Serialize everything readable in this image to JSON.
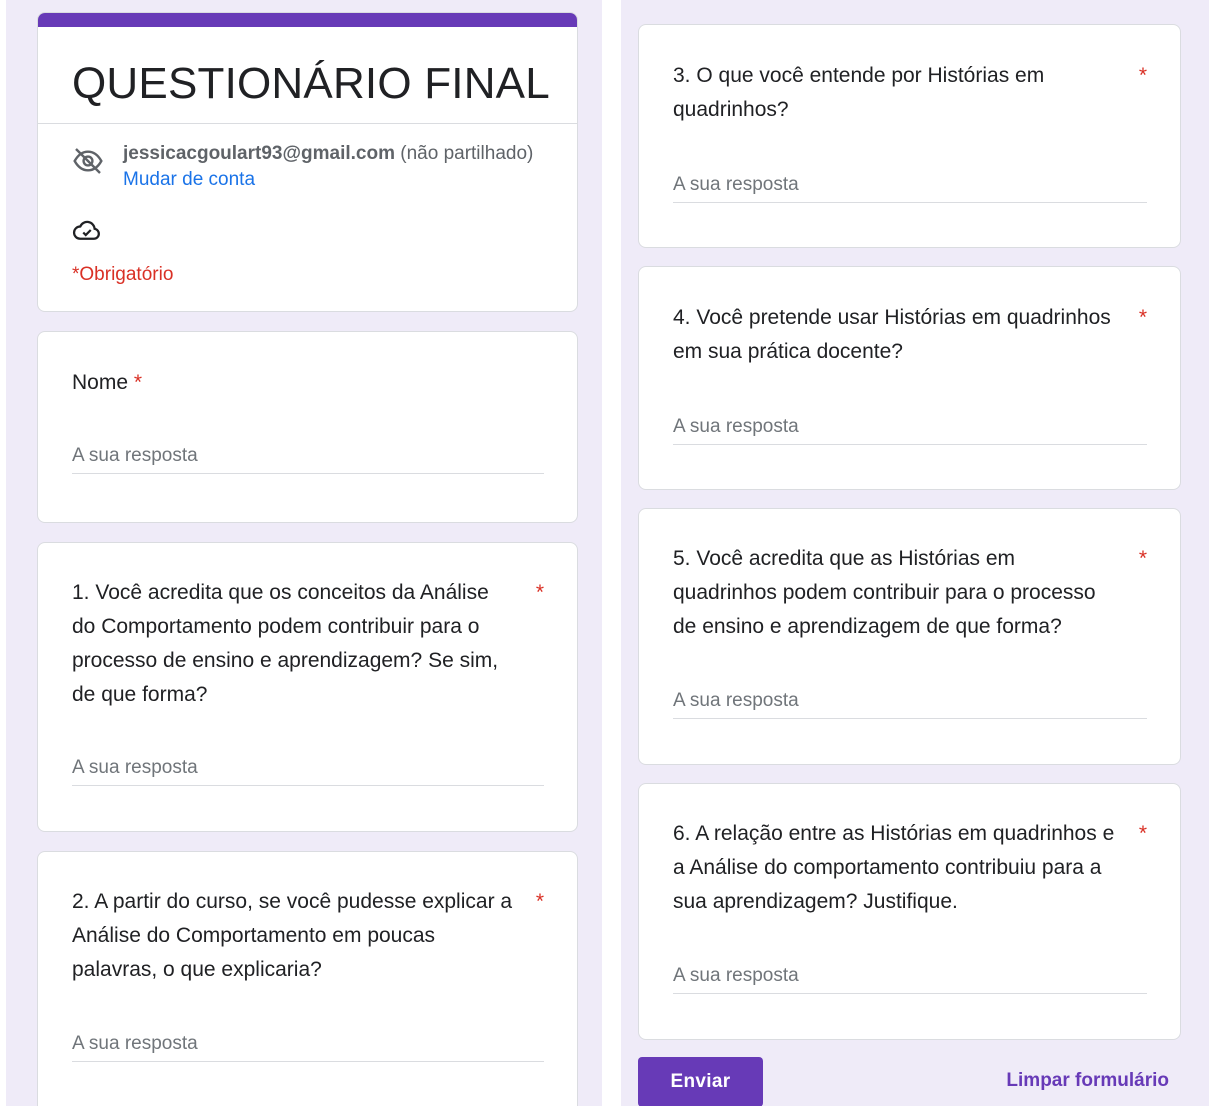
{
  "header": {
    "title": "QUESTIONÁRIO FINAL",
    "email": "jessicacgoulart93@gmail.com",
    "not_shared": "(não partilhado)",
    "switch_account": "Mudar de conta",
    "required_note": "*Obrigatório"
  },
  "colors": {
    "accent": "#673ab7",
    "link": "#1a73e8",
    "required": "#d93025",
    "background": "#efebf8"
  },
  "icons": {
    "account": "eye-off-icon",
    "save_status": "cloud-check-icon"
  },
  "answer_placeholder": "A sua resposta",
  "questions": [
    {
      "text": "Nome",
      "required_mark": "*"
    },
    {
      "text": "1. Você acredita que os conceitos da Análise do Comportamento podem contribuir para o processo de ensino e aprendizagem? Se sim, de que forma?",
      "required_mark": "*"
    },
    {
      "text": "2. A partir do curso, se você pudesse explicar a Análise do Comportamento em poucas palavras, o que explicaria?",
      "required_mark": "*"
    },
    {
      "text": "3. O que você entende por Histórias em quadrinhos?",
      "required_mark": "*"
    },
    {
      "text": "4. Você pretende usar Histórias em quadrinhos em sua prática docente?",
      "required_mark": "*"
    },
    {
      "text": "5. Você acredita que as Histórias em quadrinhos podem contribuir para o processo de ensino e aprendizagem de que forma?",
      "required_mark": "*"
    },
    {
      "text": "6. A relação entre as Histórias em quadrinhos e a Análise do comportamento contribuiu para a sua aprendizagem? Justifique.",
      "required_mark": "*"
    }
  ],
  "actions": {
    "submit": "Enviar",
    "clear": "Limpar formulário"
  }
}
